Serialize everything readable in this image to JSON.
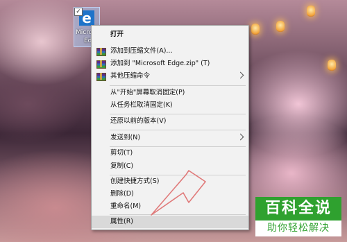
{
  "desktop": {
    "icon": {
      "name": "Microsoft Edge",
      "label_lines": [
        "Micro",
        "Ed"
      ],
      "glyph": "e",
      "icon_name": "edge-icon",
      "selected": true
    }
  },
  "context_menu": {
    "items": [
      {
        "label": "打开",
        "bold": true
      },
      {
        "label": "添加到压缩文件(A)...",
        "icon": "winrar-icon"
      },
      {
        "label": "添加到 \"Microsoft Edge.zip\" (T)",
        "icon": "winrar-icon"
      },
      {
        "label": "其他压缩命令",
        "icon": "winrar-icon",
        "submenu": true
      },
      {
        "label": "从\"开始\"屏幕取消固定(P)"
      },
      {
        "label": "从任务栏取消固定(K)"
      },
      {
        "label": "还原以前的版本(V)"
      },
      {
        "label": "发送到(N)",
        "submenu": true
      },
      {
        "label": "剪切(T)"
      },
      {
        "label": "复制(C)"
      },
      {
        "label": "创建快捷方式(S)"
      },
      {
        "label": "删除(D)"
      },
      {
        "label": "重命名(M)"
      },
      {
        "label": "属性(R)",
        "highlighted": true
      }
    ]
  },
  "annotation": {
    "type": "arrow",
    "color": "#e07a7a",
    "points_to": "属性(R)"
  },
  "watermark": {
    "title": "百科全说",
    "subtitle": "助你轻松解决",
    "color": "#2fa12f"
  }
}
